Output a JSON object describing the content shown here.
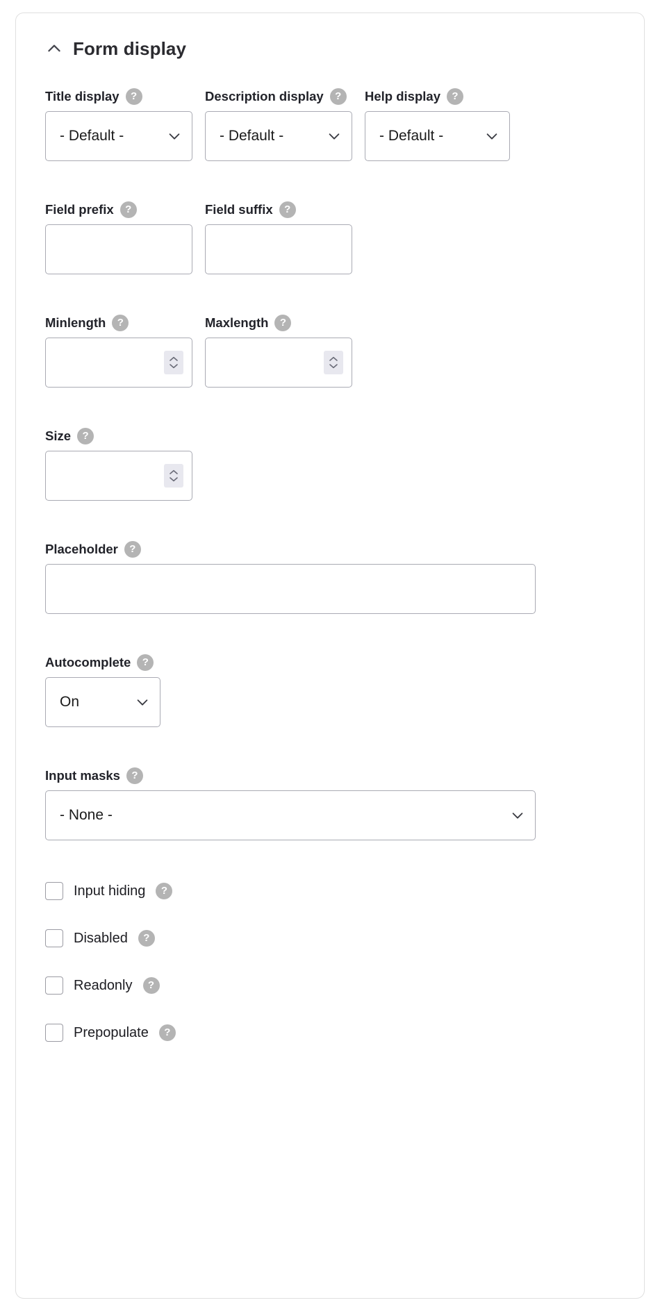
{
  "panel": {
    "title": "Form display",
    "collapse_icon": "chevron-up-icon",
    "help_glyph": "?"
  },
  "display_row": {
    "title_display": {
      "label": "Title display",
      "value": "- Default -",
      "help": "?"
    },
    "description_display": {
      "label": "Description display",
      "value": "- Default -",
      "help": "?"
    },
    "help_display": {
      "label": "Help display",
      "value": "- Default -",
      "help": "?"
    }
  },
  "affix_row": {
    "field_prefix": {
      "label": "Field prefix",
      "value": "",
      "help": "?"
    },
    "field_suffix": {
      "label": "Field suffix",
      "value": "",
      "help": "?"
    }
  },
  "length_row": {
    "minlength": {
      "label": "Minlength",
      "value": "",
      "help": "?"
    },
    "maxlength": {
      "label": "Maxlength",
      "value": "",
      "help": "?"
    }
  },
  "size": {
    "label": "Size",
    "value": "",
    "help": "?"
  },
  "placeholder": {
    "label": "Placeholder",
    "value": "",
    "help": "?"
  },
  "autocomplete": {
    "label": "Autocomplete",
    "value": "On",
    "help": "?"
  },
  "input_masks": {
    "label": "Input masks",
    "value": "- None -",
    "help": "?"
  },
  "checkboxes": [
    {
      "label": "Input hiding",
      "checked": false,
      "help": "?"
    },
    {
      "label": "Disabled",
      "checked": false,
      "help": "?"
    },
    {
      "label": "Readonly",
      "checked": false,
      "help": "?"
    },
    {
      "label": "Prepopulate",
      "checked": false,
      "help": "?"
    }
  ],
  "colors": {
    "panel_border": "#dfdfdf",
    "control_border": "#a9aab3",
    "help_bubble": "#b4b4b4",
    "text": "#22232a",
    "spinner_bg": "#e8e8ef"
  }
}
